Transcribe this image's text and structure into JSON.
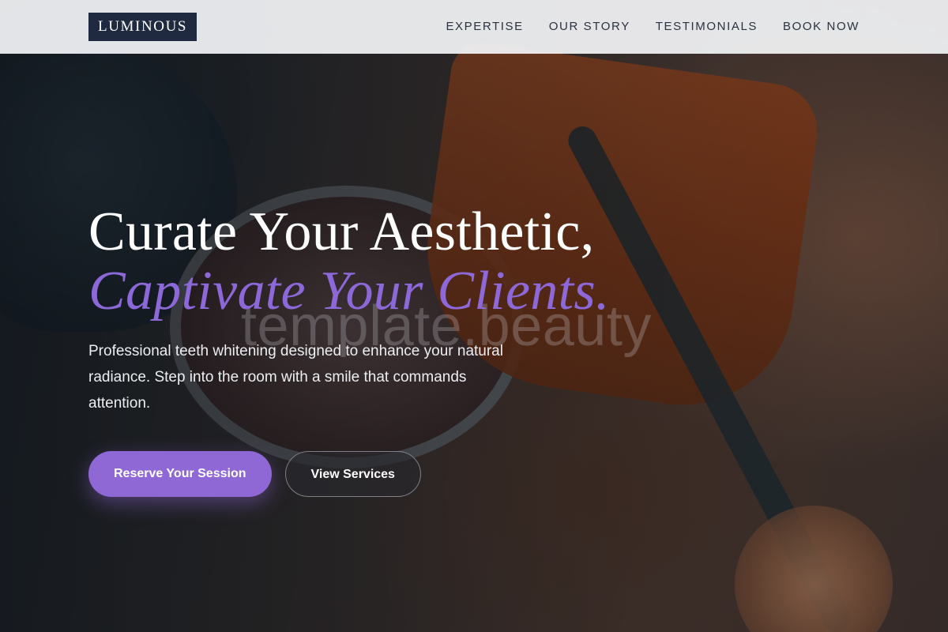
{
  "header": {
    "logo": "LUMINOUS",
    "nav": [
      {
        "label": "EXPERTISE"
      },
      {
        "label": "OUR STORY"
      },
      {
        "label": "TESTIMONIALS"
      },
      {
        "label": "BOOK NOW"
      }
    ]
  },
  "hero": {
    "headline_line1": "Curate Your Aesthetic,",
    "headline_line2": "Captivate Your Clients.",
    "subtext": "Professional teeth whitening designed to enhance your natural radiance. Step into the room with a smile that commands attention.",
    "primary_button": "Reserve Your Session",
    "secondary_button": "View Services"
  },
  "watermark": "template.beauty",
  "colors": {
    "accent": "#8d68d8",
    "logo_bg": "#1f2a40",
    "header_bg": "#f0f1f3"
  }
}
